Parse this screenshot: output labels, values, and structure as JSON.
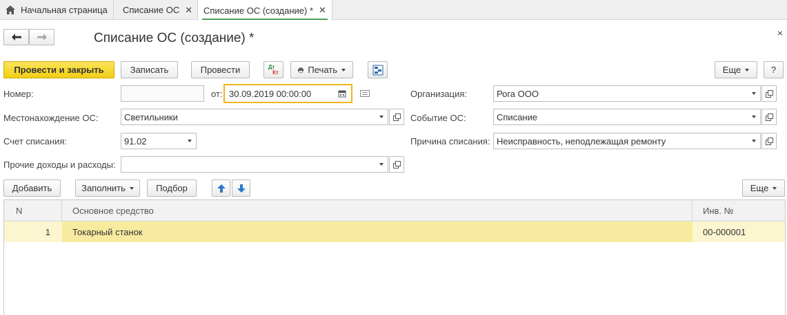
{
  "tabs": [
    {
      "label": "Начальная страница",
      "icon": "home-icon"
    },
    {
      "label": "Списание ОС",
      "close": "✕"
    },
    {
      "label": "Списание ОС (создание) *",
      "close": "✕"
    }
  ],
  "nav": {
    "back": "🡐",
    "forward": "🡒"
  },
  "title": "Списание ОС (создание) *",
  "close": "×",
  "toolbar": {
    "post_close": "Провести и закрыть",
    "save": "Записать",
    "post": "Провести",
    "dtkt_dt": "Дт",
    "dtkt_kt": "Кт",
    "print": "Печать",
    "more": "Еще",
    "help": "?"
  },
  "form": {
    "number_label": "Номер:",
    "number_value": "",
    "from_label": "от:",
    "date_value": "30.09.2019 00:00:00",
    "org_label": "Организация:",
    "org_value": "Рога ООО",
    "location_label": "Местонахождение ОС:",
    "location_value": "Светильники",
    "event_label": "Событие ОС:",
    "event_value": "Списание",
    "account_label": "Счет списания:",
    "account_value": "91.02",
    "reason_label": "Причина списания:",
    "reason_value": "Неисправность, неподлежащая ремонту",
    "other_label": "Прочие доходы и расходы:",
    "other_value": ""
  },
  "table_toolbar": {
    "add": "Добавить",
    "fill": "Заполнить",
    "select": "Подбор",
    "more": "Еще"
  },
  "table": {
    "headers": {
      "n": "N",
      "asset": "Основное средство",
      "inv": "Инв. №"
    },
    "rows": [
      {
        "n": "1",
        "asset": "Токарный станок",
        "inv": "00-000001"
      }
    ]
  },
  "colors": {
    "accent": "#f2cd14",
    "active_tab": "#4a9e5c",
    "row_highlight": "#fbf6cf"
  }
}
